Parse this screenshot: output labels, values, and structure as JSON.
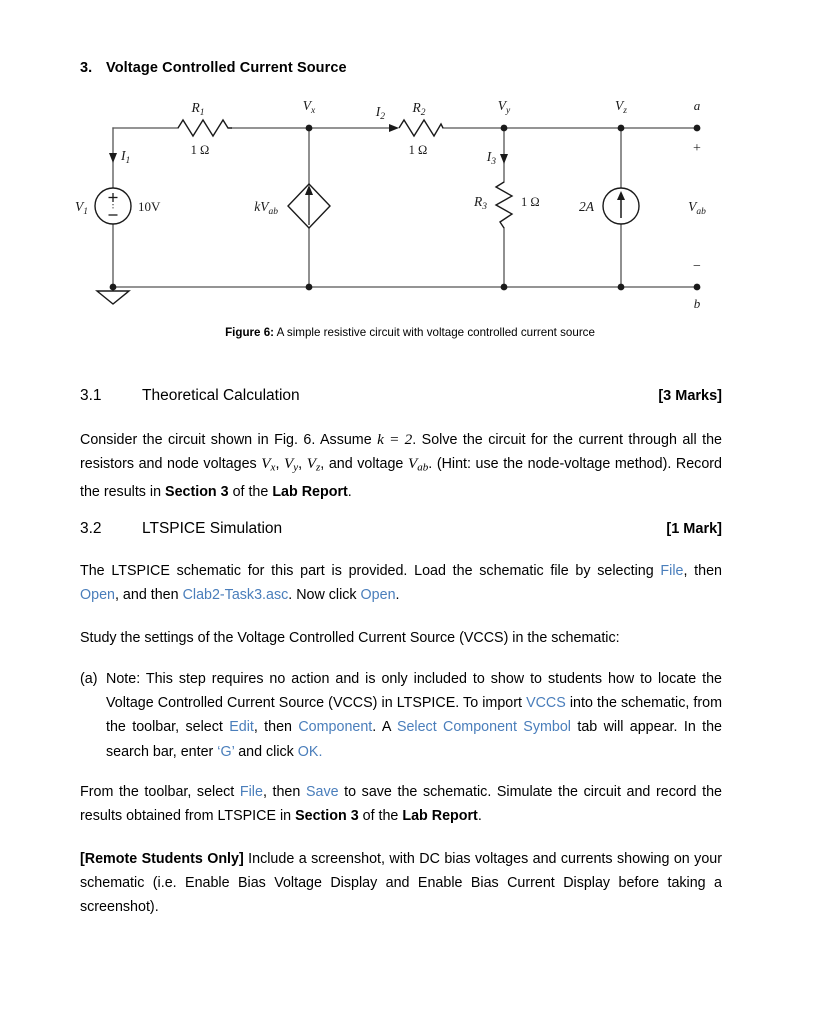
{
  "task": {
    "number": "3.",
    "title": "Voltage Controlled Current Source"
  },
  "figure": {
    "caption_label": "Figure 6:",
    "caption_text": " A simple resistive circuit with voltage controlled current source",
    "circuit": {
      "source_v1_label": "V",
      "source_v1_sub": "1",
      "source_v1_value": "10V",
      "current_i1": "I",
      "current_i1_sub": "1",
      "current_i2": "I",
      "current_i2_sub": "2",
      "current_i3": "I",
      "current_i3_sub": "3",
      "r1_label": "R",
      "r1_sub": "1",
      "r1_value": "1 Ω",
      "r2_label": "R",
      "r2_sub": "2",
      "r2_value": "1 Ω",
      "r3_label": "R",
      "r3_sub": "3",
      "r3_value": "1 Ω",
      "node_vx": "V",
      "node_vx_sub": "x",
      "node_vy": "V",
      "node_vy_sub": "y",
      "node_vz": "V",
      "node_vz_sub": "z",
      "vccs_label_k": "kV",
      "vccs_label_sub": "ab",
      "current_source_value": "2A",
      "terminal_a": "a",
      "terminal_b": "b",
      "terminal_plus": "+",
      "terminal_minus": "−",
      "vab_label": "V",
      "vab_sub": "ab",
      "source_plus": "+",
      "source_minus": "−"
    }
  },
  "sections": {
    "s31": {
      "number": "3.1",
      "title": "Theoretical Calculation",
      "marks": "[3 Marks]"
    },
    "s32": {
      "number": "3.2",
      "title": "LTSPICE Simulation",
      "marks": "[1 Mark]"
    }
  },
  "paragraphs": {
    "theory": {
      "p1": "Consider the circuit shown in Fig. 6. Assume ",
      "k_eq": "k = 2",
      "p2": ". Solve the circuit for the current through all the resistors and node voltages ",
      "vx": "V",
      "vx_sub": "x",
      "comma1": ", ",
      "vy": "V",
      "vy_sub": "y",
      "comma2": ", ",
      "vz": "V",
      "vz_sub": "z",
      "p3": ", and voltage ",
      "vab": "V",
      "vab_sub": "ab",
      "p4": ". (Hint: use the node-voltage method). Record the results in ",
      "section3": "Section 3",
      "p5": " of the ",
      "labreport": "Lab Report",
      "p6": "."
    },
    "ltspice": {
      "p1": "The LTSPICE schematic for this part is provided. Load the schematic file by selecting ",
      "link_file": "File",
      "p2": ", then ",
      "link_open": "Open",
      "p3": ", and then ",
      "link_filename": "Clab2-Task3.asc",
      "p4": ". Now click ",
      "link_open2": "Open",
      "p5": "."
    },
    "study": {
      "text": "Study the settings of the Voltage Controlled Current Source (VCCS) in the schematic:"
    },
    "note_a": {
      "marker": "(a)",
      "p1": "Note: This step requires no action and is only included to show to students how to locate the Voltage Controlled Current Source (VCCS) in LTSPICE. To import ",
      "link_vccs": "VCCS",
      "p2": " into the schematic, from the toolbar, select ",
      "link_edit": "Edit",
      "p3": ", then ",
      "link_component": "Component",
      "p4": ". A ",
      "link_select_symbol": "Select Component Symbol",
      "p5": " tab will appear. In the search bar, enter ",
      "link_g": "‘G’",
      "p6": " and click ",
      "link_ok": "OK.",
      "p7": ""
    },
    "save": {
      "p1": "From the toolbar, select ",
      "link_file": "File",
      "p2": ", then ",
      "link_save": "Save",
      "p3": " to save the schematic. Simulate the circuit and record the results obtained from LTSPICE in ",
      "section3": "Section 3",
      "p4": " of the ",
      "labreport": "Lab Report",
      "p5": "."
    },
    "remote": {
      "bold_lead": "[Remote Students Only]",
      "text": " Include a screenshot, with DC bias voltages and currents showing on your schematic (i.e. Enable Bias Voltage Display and Enable Bias Current Display before taking a screenshot)."
    }
  },
  "colors": {
    "link": "#4a7ebb",
    "text": "#000000",
    "wire": "#555555",
    "component": "#1a1a1a"
  }
}
